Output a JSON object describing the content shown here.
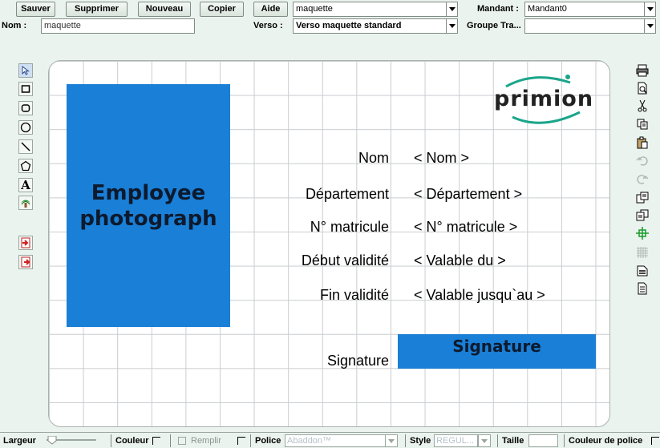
{
  "toolbar": {
    "save_label": "Sauver",
    "delete_label": "Supprimer",
    "new_label": "Nouveau",
    "copy_label": "Copier",
    "help_label": "Aide",
    "template_select_value": "maquette",
    "client_label": "Mandant :",
    "client_value": "Mandant0"
  },
  "second_row": {
    "name_label": "Nom :",
    "name_value": "maquette",
    "back_label": "Verso :",
    "back_value": "Verso maquette standard",
    "group_label": "Groupe Tra...",
    "group_value": ""
  },
  "palette_tools": [
    "pointer-tool",
    "rectangle-tool",
    "rounded-rectangle-tool",
    "ellipse-tool",
    "line-tool",
    "polygon-tool",
    "text-tool",
    "image-tool",
    "import-icon",
    "export-icon"
  ],
  "card": {
    "photo_line1": "Employee",
    "photo_line2": "photograph",
    "logo_text": "primion",
    "fields": [
      {
        "label": "Nom",
        "value": "< Nom >"
      },
      {
        "label": "Département",
        "value": "< Département >"
      },
      {
        "label": "N° matricule",
        "value": "< N° matricule >"
      },
      {
        "label": "Début validité",
        "value": "< Valable du >"
      },
      {
        "label": "Fin validité",
        "value": "< Valable jusqu`au >"
      }
    ],
    "signature_label": "Signature",
    "signature_box_text": "Signature"
  },
  "right_tools": [
    "print-icon",
    "print-preview-icon",
    "cut-icon",
    "copy-icon",
    "paste-icon",
    "undo-icon",
    "redo-icon",
    "bring-forward-icon",
    "send-backward-icon",
    "center-icon",
    "grid-icon",
    "align-icon",
    "page-icon"
  ],
  "status": {
    "width_label": "Largeur",
    "color_label": "Couleur",
    "fill_label": "Remplir",
    "font_label": "Police",
    "font_value": "Abaddon™",
    "style_label": "Style",
    "style_value": "REGUL...",
    "size_label": "Taille",
    "size_value": "",
    "font_color_label": "Couleur de police"
  },
  "colors": {
    "background": "#ebf3ee",
    "card_blue": "#1a7fd6",
    "logo_teal": "#1aa58a"
  }
}
